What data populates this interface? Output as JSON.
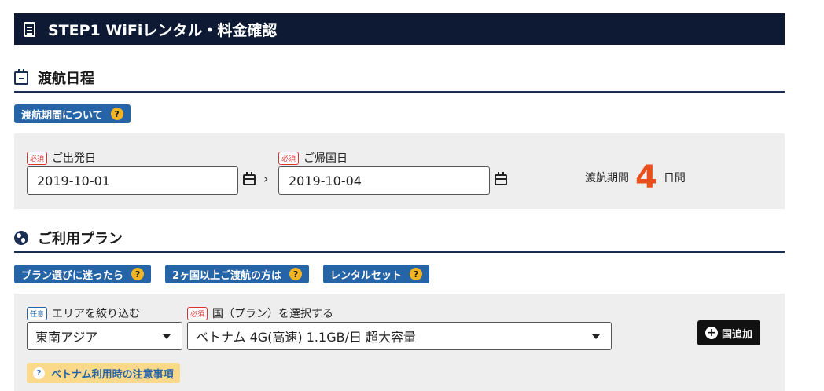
{
  "header": {
    "title": "STEP1 WiFiレンタル・料金確認"
  },
  "travel": {
    "section_title": "渡航日程",
    "period_info_button": "渡航期間について",
    "required_badge": "必須",
    "departure_label": "ご出発日",
    "departure_value": "2019-10-01",
    "return_label": "ご帰国日",
    "return_value": "2019-10-04",
    "duration_prefix": "渡航期間",
    "duration_days": "4",
    "duration_suffix": "日間"
  },
  "plan": {
    "section_title": "ご利用プラン",
    "buttons": [
      "プラン選びに迷ったら",
      "2ヶ国以上ご渡航の方は",
      "レンタルセット"
    ],
    "optional_badge": "任意",
    "required_badge": "必須",
    "area_label": "エリアを絞り込む",
    "area_value": "東南アジア",
    "country_label": "国（プラン）を選択する",
    "country_value": "ベトナム 4G(高速) 1.1GB/日 超大容量",
    "add_country_button": "国追加",
    "notice_text": "ベトナム利用時の注意事項"
  },
  "colors": {
    "accent": "#e94e1b",
    "navy": "#0e1a33",
    "blue": "#2664a8",
    "notice": "#fbd98a"
  },
  "icons": {
    "header": "document-icon",
    "travel": "calendar-icon",
    "plan": "globe-icon",
    "help": "question-icon",
    "add": "plus-circle-icon"
  }
}
